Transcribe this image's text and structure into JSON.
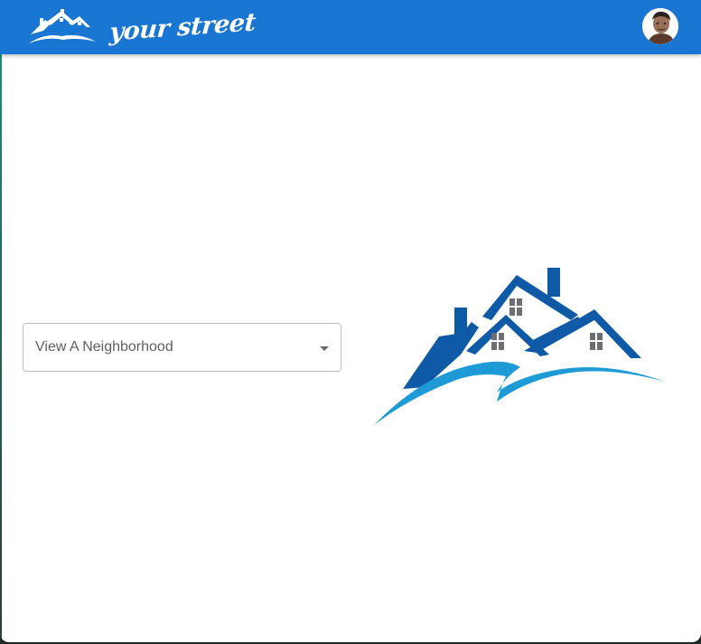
{
  "header": {
    "brand_text": "your street",
    "logo_icon": "houses-roof-icon",
    "avatar_icon": "user-avatar"
  },
  "main": {
    "neighborhood_select": {
      "label": "View A Neighborhood",
      "caret_icon": "caret-down-icon"
    },
    "hero_icon": "houses-roof-logo"
  },
  "colors": {
    "appbar": "#1976d2",
    "logo_dark_blue": "#0e5aa7",
    "logo_light_blue": "#1e9ad6",
    "window_gray": "#6d6e71"
  }
}
